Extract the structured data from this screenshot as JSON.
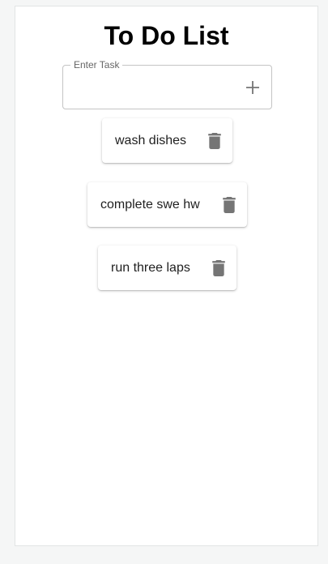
{
  "header": {
    "title": "To Do List"
  },
  "task_input": {
    "label": "Enter Task",
    "value": "",
    "add_icon": "plus-icon"
  },
  "todos": [
    {
      "text": "wash dishes",
      "delete_icon": "trash-icon"
    },
    {
      "text": "complete swe hw",
      "delete_icon": "trash-icon"
    },
    {
      "text": "run three laps",
      "delete_icon": "trash-icon"
    }
  ],
  "colors": {
    "page_background": "#f5f6f6",
    "card_background": "#ffffff",
    "icon": "#757575",
    "title": "#000000"
  }
}
